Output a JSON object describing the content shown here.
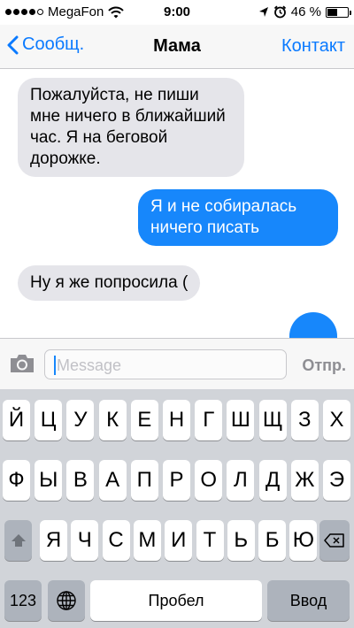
{
  "status_bar": {
    "carrier": "MegaFon",
    "time": "9:00",
    "battery_percent": "46 %",
    "battery_level": 0.46
  },
  "nav": {
    "back_label": "Сообщ.",
    "title": "Мама",
    "contact_label": "Контакт"
  },
  "messages": [
    {
      "direction": "incoming",
      "text": "Пожалуйста, не пиши мне ничего в ближайший час. Я на беговой дорожке."
    },
    {
      "direction": "outgoing",
      "text": "Я и не собиралась ничего писать"
    },
    {
      "direction": "incoming",
      "text": "Ну я же попросила ("
    },
    {
      "direction": "outgoing",
      "text": ""
    }
  ],
  "input_bar": {
    "placeholder": "Message",
    "send_label": "Отпр."
  },
  "keyboard": {
    "row1": [
      "Й",
      "Ц",
      "У",
      "К",
      "Е",
      "Н",
      "Г",
      "Ш",
      "Щ",
      "З",
      "Х"
    ],
    "row2": [
      "Ф",
      "Ы",
      "В",
      "А",
      "П",
      "Р",
      "О",
      "Л",
      "Д",
      "Ж",
      "Э"
    ],
    "row3": [
      "Я",
      "Ч",
      "С",
      "М",
      "И",
      "Т",
      "Ь",
      "Б",
      "Ю"
    ],
    "numbers_label": "123",
    "space_label": "Пробел",
    "return_label": "Ввод"
  },
  "icons": {
    "signal": "signal-dots-icon",
    "wifi": "wifi-icon",
    "location": "location-arrow-icon",
    "alarm": "alarm-clock-icon",
    "battery": "battery-icon",
    "back": "chevron-left-icon",
    "camera": "camera-icon",
    "shift": "shift-icon",
    "delete": "delete-icon",
    "globe": "globe-icon"
  },
  "colors": {
    "accent": "#0a7aff",
    "outgoing_bubble": "#1787fb",
    "incoming_bubble": "#e5e5ea",
    "keyboard_bg": "#d1d4d9",
    "key_dark": "#adb3bc"
  }
}
